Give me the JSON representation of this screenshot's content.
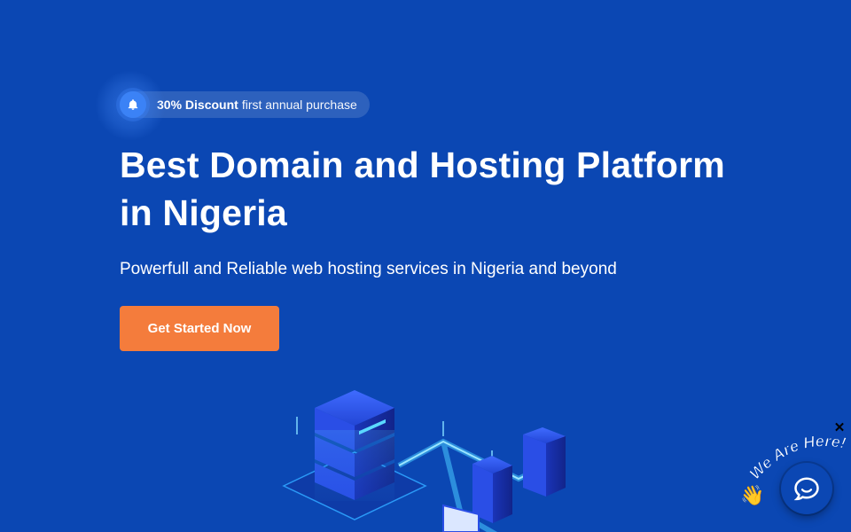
{
  "promo": {
    "bold": "30% Discount",
    "text": "first annual purchase",
    "icon": "bell-icon"
  },
  "hero": {
    "title_line1": "Best Domain and Hosting Platform",
    "title_line2": "in Nigeria",
    "subtitle": "Powerfull and Reliable web hosting services in Nigeria and beyond",
    "cta_label": "Get Started Now"
  },
  "chat": {
    "tagline": "We Are Here!",
    "close_label": "✕",
    "icon": "chat-bubble-icon",
    "wave_icon": "waving-hand-icon"
  },
  "colors": {
    "background": "#0b47b3",
    "accent": "#f47c3c",
    "badge": "#3b82f6"
  }
}
